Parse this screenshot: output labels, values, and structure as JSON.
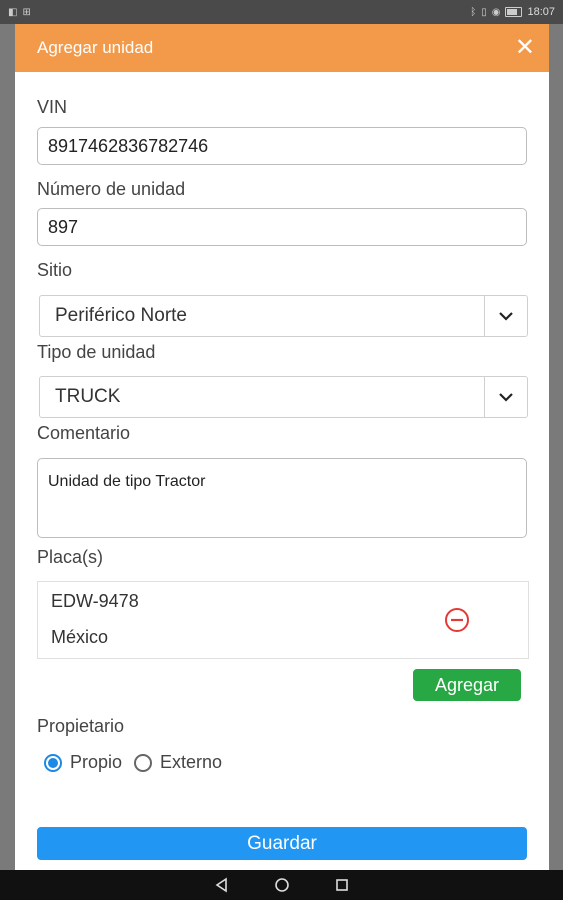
{
  "status_bar": {
    "time": "18:07"
  },
  "modal": {
    "title": "Agregar unidad",
    "close_glyph": "✕"
  },
  "form": {
    "vin": {
      "label": "VIN",
      "value": "8917462836782746"
    },
    "unit_number": {
      "label": "Número de unidad",
      "value": "897"
    },
    "site": {
      "label": "Sitio",
      "selected": "Periférico Norte"
    },
    "unit_type": {
      "label": "Tipo de unidad",
      "selected": "TRUCK"
    },
    "comment": {
      "label": "Comentario",
      "value": "Unidad de tipo Tractor"
    },
    "plates": {
      "label": "Placa(s)",
      "items": [
        {
          "number": "EDW-9478",
          "country": "México"
        }
      ],
      "add_button": "Agregar"
    },
    "owner": {
      "label": "Propietario",
      "options": [
        {
          "label": "Propio",
          "checked": true
        },
        {
          "label": "Externo",
          "checked": false
        }
      ]
    },
    "save_button": "Guardar"
  },
  "colors": {
    "header": "#f2994a",
    "add": "#28a745",
    "save": "#2196f3",
    "remove": "#e53935",
    "radio": "#1e88e5"
  },
  "icons": [
    "bluetooth-icon",
    "vibrate-icon",
    "wifi-icon",
    "battery-icon",
    "back-icon",
    "home-icon",
    "recents-icon",
    "chevron-down-icon",
    "remove-circle-icon"
  ]
}
